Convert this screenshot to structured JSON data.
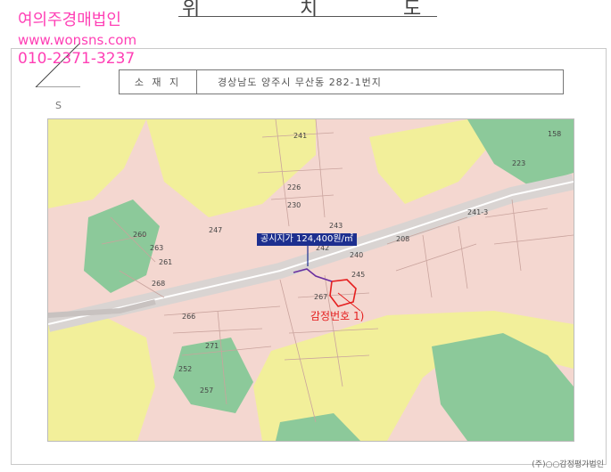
{
  "header": {
    "title_chars": [
      "위",
      "치",
      "도"
    ]
  },
  "watermark": {
    "company": "여의주경매법인",
    "website": "www.wonsns.com",
    "phone": "010-2371-3237"
  },
  "address_box": {
    "label": "소 재 지",
    "value": "경상남도 양주시 무산동 282-1번지"
  },
  "map": {
    "scale_mark": "S",
    "price_label": "공시지가 124,400원/㎡",
    "subject_label": "감정번호 1)",
    "colors": {
      "land_pink": "#f4d7d0",
      "forest_green": "#8cc99a",
      "farmland_yellow": "#f2ef9a",
      "road_grey": "#d9d4d2",
      "price_box": "#1d2f8f",
      "subject_marker": "#e51f1f"
    },
    "lot_numbers": [
      "241",
      "230",
      "226",
      "247",
      "260",
      "263",
      "261",
      "268",
      "266",
      "271",
      "252",
      "257",
      "243",
      "242",
      "240",
      "267",
      "245",
      "208",
      "223",
      "241-3",
      "158"
    ]
  },
  "footer": {
    "source_note": "(주)○○감정평가법인"
  }
}
